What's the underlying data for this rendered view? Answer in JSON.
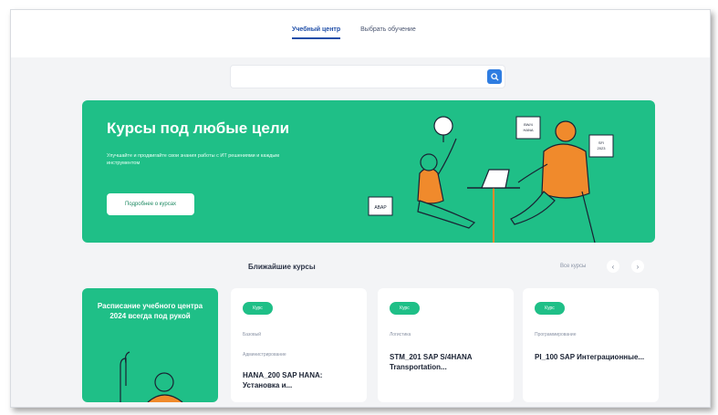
{
  "nav": {
    "tabs": [
      {
        "label": "Учебный центр",
        "active": true
      },
      {
        "label": "Выбрать обучение",
        "active": false
      }
    ]
  },
  "search": {
    "value": "",
    "placeholder": "",
    "icon": "search-icon"
  },
  "hero": {
    "title": "Курсы под любые цели",
    "subtitle": "Улучшайте и продвигайте свои знания работы с ИТ решениями и каждым инструментом",
    "button_label": "Подробнее о курсах",
    "tags": [
      "ABAP",
      "BW/4 HANA",
      "S/4 HANA",
      "SFI 2023"
    ]
  },
  "courses": {
    "section_title": "Ближайшие курсы",
    "all_link": "Все курсы",
    "prev_icon": "chevron-left-icon",
    "next_icon": "chevron-right-icon",
    "promo_text": "Расписание учебного центра 2024 всегда под рукой",
    "items": [
      {
        "badge": "Курс",
        "meta1": "Базовый",
        "meta2": "Администрирование",
        "title": "HANA_200 SAP HANA: Установка и..."
      },
      {
        "badge": "Курс",
        "meta1": "Логистика",
        "title": "STM_201 SAP S/4HANA Transportation..."
      },
      {
        "badge": "Курс",
        "meta1": "Программирование",
        "title": "PI_100 SAP Интеграционные..."
      }
    ]
  },
  "colors": {
    "accent_green": "#1fbf87",
    "accent_orange": "#f08a2c",
    "link_blue": "#1f4ea8",
    "search_blue": "#2f7de1"
  }
}
